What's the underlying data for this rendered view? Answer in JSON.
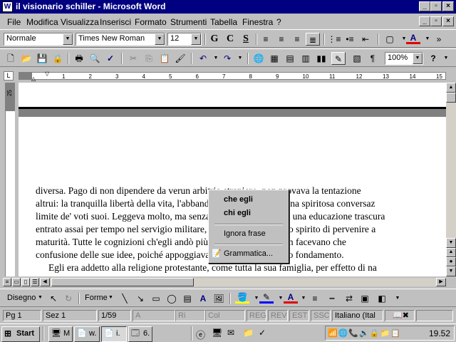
{
  "window": {
    "title": "il visionario schiller - Microsoft Word"
  },
  "menu": [
    "File",
    "Modifica",
    "Visualizza",
    "Inserisci",
    "Formato",
    "Strumenti",
    "Tabella",
    "Finestra",
    "?"
  ],
  "format_toolbar": {
    "style": "Normale",
    "font": "Times New Roman",
    "size": "12",
    "bold": "G",
    "italic": "C",
    "underline": "S"
  },
  "standard_toolbar": {
    "zoom": "100%"
  },
  "ruler": {
    "numbers": [
      "1",
      "2",
      "3",
      "4",
      "5",
      "6",
      "7",
      "8",
      "9",
      "10",
      "11",
      "12",
      "13",
      "14",
      "15"
    ]
  },
  "vruler": {
    "label": "25"
  },
  "document": {
    "lines": [
      "diversa. Pago di non dipendere da verun arbitrio straniero, non provava la tentazione",
      "altrui: la tranquilla libertà della vita, l'abbandono al godimento d'una spiritosa conversaz",
      "limite de' voti suoi. Leggeva molto, ma senza la scelta dell'ottimo: una educazione trascura",
      "entrato assai per tempo nel servigio militare, aveva impedito al suo spirito di pervenire a",
      "maturità. Tutte le cognizioni ch'egli andò più tardi acquistando non facevano che",
      "confusione delle sue idee, poiché appoggiavano esse ad alcun sodo fondamento.",
      "Egli era addetto alla religione protestante, come tutta la sua famiglia, per effetto di na"
    ]
  },
  "context_menu": {
    "items": [
      "che egli",
      "chi egli",
      "Ignora frase",
      "Grammatica..."
    ]
  },
  "draw_toolbar": {
    "draw": "Disegno",
    "shapes": "Forme"
  },
  "status": {
    "page": "Pg 1",
    "section": "Sez 1",
    "pages": "1/59",
    "at": "A",
    "line": "Ri",
    "col": "Col",
    "rec": "REG",
    "rev": "REV",
    "ext": "EST",
    "ovr": "SSC",
    "lang": "Italiano (Ital"
  },
  "taskbar": {
    "start": "Start",
    "tasks": [
      "M",
      "w.",
      "i.",
      "6."
    ],
    "clock": "19.52"
  }
}
